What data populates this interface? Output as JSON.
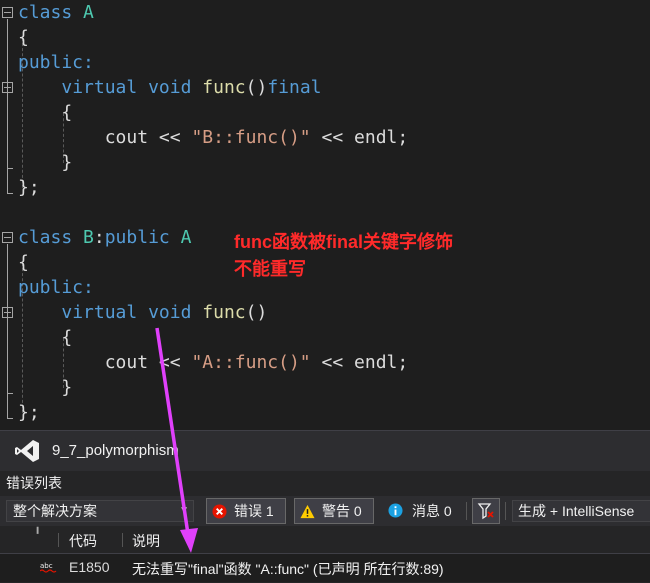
{
  "editor": {
    "class_a": {
      "line1": {
        "kw": "class",
        "name": "A"
      },
      "brace_open": "{",
      "access": "public:",
      "decl": {
        "kw1": "virtual",
        "kw2": "void",
        "fn": "func",
        "parens": "()",
        "kw3": "final"
      },
      "body_open": "{",
      "stmt": {
        "obj": "cout",
        "op1": "<<",
        "str": "\"B::func()\"",
        "op2": "<<",
        "end": "endl;"
      },
      "body_close": "}",
      "brace_close": "};"
    },
    "class_b": {
      "line1": {
        "kw": "class",
        "name": "B",
        "colon": ":",
        "kw2": "public",
        "base": "A"
      },
      "brace_open": "{",
      "access": "public:",
      "decl": {
        "kw1": "virtual",
        "kw2": "void",
        "fn": "func",
        "parens": "()"
      },
      "body_open": "{",
      "stmt": {
        "obj": "cout",
        "op1": "<<",
        "str": "\"A::func()\"",
        "op2": "<<",
        "end": "endl;"
      },
      "body_close": "}",
      "brace_close": "};"
    },
    "annotation": {
      "line1": "func函数被final关键字修饰",
      "line2": "不能重写",
      "color": "#ff2a2a"
    }
  },
  "panel": {
    "project_name": "9_7_polymorphism",
    "header": "错误列表",
    "toolbar": {
      "scope": "整个解决方案",
      "errors_label": "错误 1",
      "warnings_label": "警告 0",
      "messages_label": "消息 0",
      "build_filter": "生成 + IntelliSense"
    },
    "columns": {
      "code": "代码",
      "description": "说明"
    },
    "rows": [
      {
        "icon": "abc-error-icon",
        "code": "E1850",
        "description": "无法重写\"final\"函数 \"A::func\" (已声明 所在行数:89)"
      }
    ]
  },
  "colors": {
    "keyword": "#569cd6",
    "type": "#4ec9b0",
    "function": "#dcdcaa",
    "string": "#d69d85",
    "arrow": "#e040fb"
  }
}
